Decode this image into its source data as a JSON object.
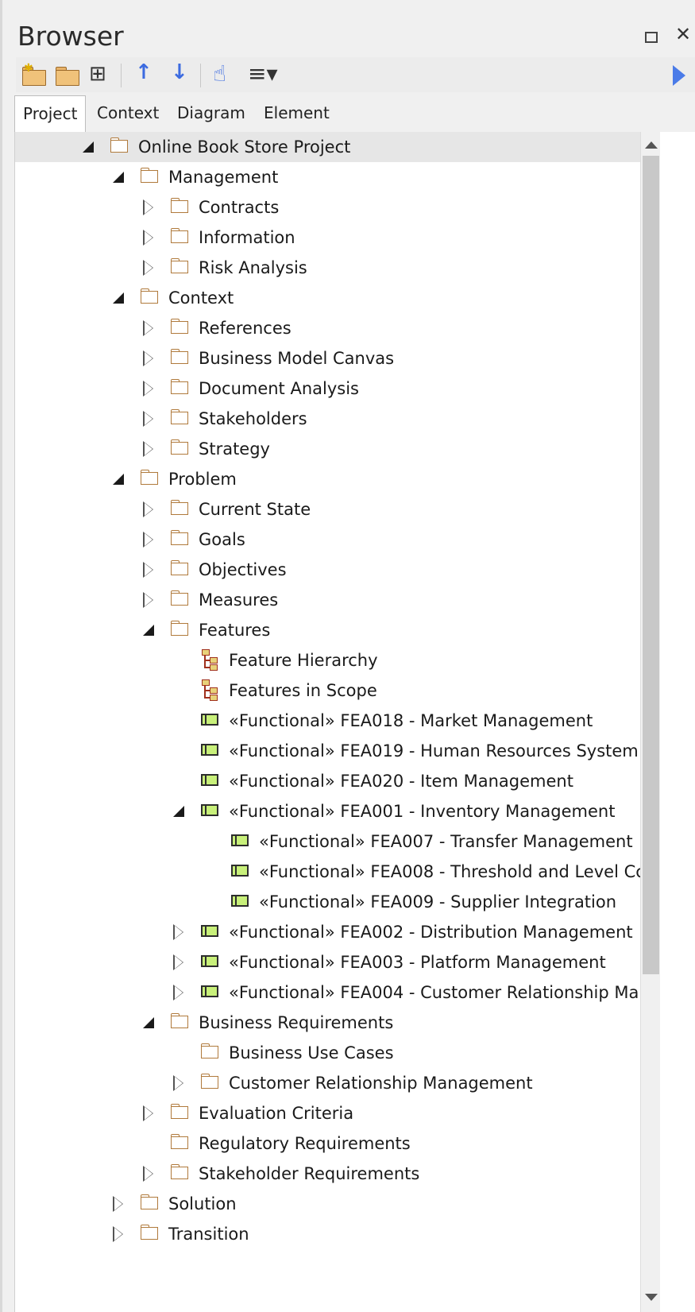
{
  "panel": {
    "title": "Browser",
    "restore_icon": "restore-icon",
    "close_icon": "close-icon"
  },
  "toolbar": {
    "icons": [
      "new-package-icon",
      "open-folder-icon",
      "hierarchy-icon",
      "move-up-icon",
      "move-down-icon",
      "locate-icon",
      "menu-icon"
    ],
    "expand_icon": "play-icon"
  },
  "tabs": [
    {
      "label": "Project",
      "active": true
    },
    {
      "label": "Context"
    },
    {
      "label": "Diagram"
    },
    {
      "label": "Element"
    }
  ],
  "tree": [
    {
      "label": "Online Book Store Project",
      "level": 0,
      "state": "open",
      "icon": "folder",
      "selected": true
    },
    {
      "label": "Management",
      "level": 1,
      "state": "open",
      "icon": "folder"
    },
    {
      "label": "Contracts",
      "level": 2,
      "state": "closed",
      "icon": "folder"
    },
    {
      "label": "Information",
      "level": 2,
      "state": "closed",
      "icon": "folder"
    },
    {
      "label": "Risk Analysis",
      "level": 2,
      "state": "closed",
      "icon": "folder"
    },
    {
      "label": "Context",
      "level": 1,
      "state": "open",
      "icon": "folder"
    },
    {
      "label": "References",
      "level": 2,
      "state": "closed",
      "icon": "folder"
    },
    {
      "label": "Business Model Canvas",
      "level": 2,
      "state": "closed",
      "icon": "folder"
    },
    {
      "label": "Document Analysis",
      "level": 2,
      "state": "closed",
      "icon": "folder"
    },
    {
      "label": "Stakeholders",
      "level": 2,
      "state": "closed",
      "icon": "folder"
    },
    {
      "label": "Strategy",
      "level": 2,
      "state": "closed",
      "icon": "folder"
    },
    {
      "label": "Problem",
      "level": 1,
      "state": "open",
      "icon": "folder"
    },
    {
      "label": "Current State",
      "level": 2,
      "state": "closed",
      "icon": "folder"
    },
    {
      "label": "Goals",
      "level": 2,
      "state": "closed",
      "icon": "folder"
    },
    {
      "label": "Objectives",
      "level": 2,
      "state": "closed",
      "icon": "folder"
    },
    {
      "label": "Measures",
      "level": 2,
      "state": "closed",
      "icon": "folder"
    },
    {
      "label": "Features",
      "level": 2,
      "state": "open",
      "icon": "folder"
    },
    {
      "label": "Feature Hierarchy",
      "level": 3,
      "state": "none",
      "icon": "diagram"
    },
    {
      "label": "Features in Scope",
      "level": 3,
      "state": "none",
      "icon": "diagram"
    },
    {
      "label": "«Functional» FEA018 - Market Management",
      "level": 3,
      "state": "none",
      "icon": "feature"
    },
    {
      "label": "«Functional» FEA019 - Human Resources System",
      "level": 3,
      "state": "none",
      "icon": "feature"
    },
    {
      "label": "«Functional» FEA020 - Item Management",
      "level": 3,
      "state": "none",
      "icon": "feature"
    },
    {
      "label": "«Functional» FEA001 - Inventory Management",
      "level": 3,
      "state": "open",
      "icon": "feature"
    },
    {
      "label": "«Functional» FEA007 - Transfer Management",
      "level": 4,
      "state": "none",
      "icon": "feature"
    },
    {
      "label": "«Functional» FEA008 - Threshold and Level Cc",
      "level": 4,
      "state": "none",
      "icon": "feature"
    },
    {
      "label": "«Functional» FEA009 - Supplier Integration",
      "level": 4,
      "state": "none",
      "icon": "feature"
    },
    {
      "label": "«Functional» FEA002 - Distribution Management",
      "level": 3,
      "state": "closed",
      "icon": "feature"
    },
    {
      "label": "«Functional» FEA003 - Platform Management",
      "level": 3,
      "state": "closed",
      "icon": "feature"
    },
    {
      "label": "«Functional» FEA004 - Customer Relationship Ma",
      "level": 3,
      "state": "closed",
      "icon": "feature"
    },
    {
      "label": "Business Requirements",
      "level": 2,
      "state": "open",
      "icon": "folder"
    },
    {
      "label": "Business Use Cases",
      "level": 3,
      "state": "none",
      "icon": "folder"
    },
    {
      "label": "Customer Relationship Management",
      "level": 3,
      "state": "closed",
      "icon": "folder"
    },
    {
      "label": "Evaluation Criteria",
      "level": 2,
      "state": "closed",
      "icon": "folder"
    },
    {
      "label": "Regulatory Requirements",
      "level": 2,
      "state": "none",
      "icon": "folder"
    },
    {
      "label": "Stakeholder Requirements",
      "level": 2,
      "state": "closed",
      "icon": "folder"
    },
    {
      "label": "Solution",
      "level": 1,
      "state": "closed",
      "icon": "folder"
    },
    {
      "label": "Transition",
      "level": 1,
      "state": "closed",
      "icon": "folder"
    }
  ]
}
